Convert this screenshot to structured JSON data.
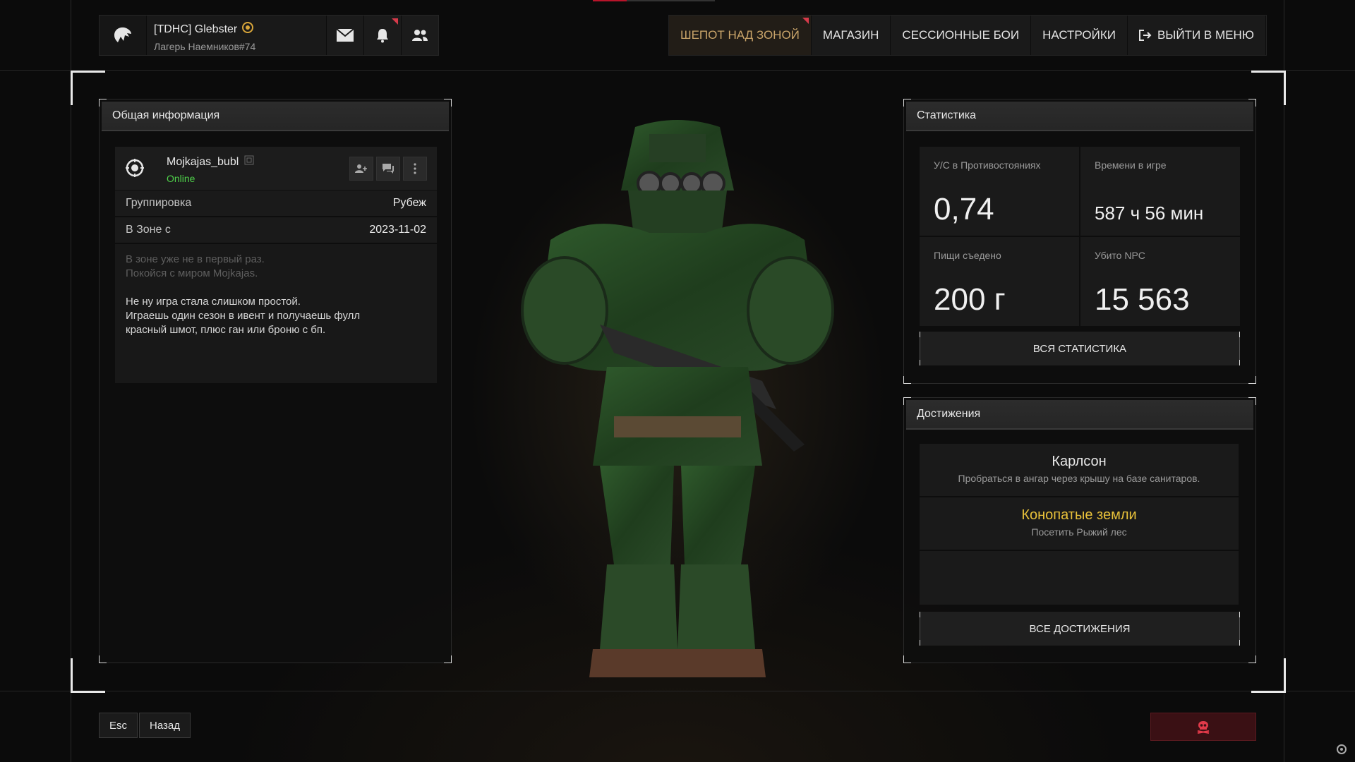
{
  "user": {
    "name": "[TDHC] Glebster",
    "subtitle": "Лагерь Наемников#74"
  },
  "nav": {
    "items": [
      {
        "label": "ШЕПОТ НАД ЗОНОЙ",
        "active": true
      },
      {
        "label": "МАГАЗИН"
      },
      {
        "label": "СЕССИОННЫЕ БОИ"
      },
      {
        "label": "НАСТРОЙКИ"
      },
      {
        "label": "ВЫЙТИ В МЕНЮ"
      }
    ]
  },
  "general": {
    "title": "Общая информация",
    "player_name": "Mojkajas_bubl",
    "status": "Online",
    "rows": [
      {
        "key": "Группировка",
        "value": "Рубеж"
      },
      {
        "key": "В Зоне с",
        "value": "2023-11-02"
      }
    ],
    "bio_placeholder": [
      "В зоне уже не в первый раз.",
      "Покойся с миром Mojkajas."
    ],
    "bio_text": [
      "Не ну игра стала слишком простой.",
      "Играешь один сезон в ивент и получаешь фулл",
      "красный шмот, плюс ган или броню с бп."
    ]
  },
  "stats": {
    "title": "Статистика",
    "cells": [
      {
        "label": "У/С в Противостояниях",
        "value": "0,74"
      },
      {
        "label": "Времени в игре",
        "value": "587 ч 56 мин"
      },
      {
        "label": "Пищи съедено",
        "value": "200 г"
      },
      {
        "label": "Убито NPC",
        "value": "15 563"
      }
    ],
    "button": "ВСЯ СТАТИСТИКА"
  },
  "achievements": {
    "title": "Достижения",
    "items": [
      {
        "title": "Карлсон",
        "desc": "Пробраться в ангар через крышу на базе санитаров.",
        "color": "#e8e8e8"
      },
      {
        "title": "Конопатые земли",
        "desc": "Посетить Рыжий лес",
        "color": "#e8c13a"
      }
    ],
    "button": "ВСЕ ДОСТИЖЕНИЯ"
  },
  "bottom": {
    "esc": "Esc",
    "back": "Назад"
  },
  "colors": {
    "accent": "#caa56a",
    "online": "#4fd14a",
    "danger": "#d53a4a"
  }
}
